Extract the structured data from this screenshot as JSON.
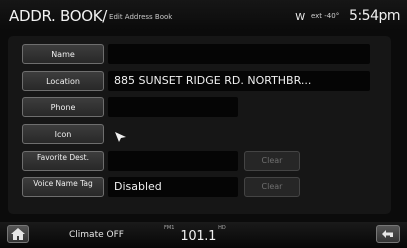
{
  "header": {
    "title": "ADDR. BOOK/",
    "subtitle": "Edit Address Book",
    "compass_icon": "compass-w-icon",
    "compass": "W",
    "outside_temp": "ext -40°",
    "time": "5:54pm"
  },
  "rows": [
    {
      "label": "Name",
      "value": ""
    },
    {
      "label": "Location",
      "value": "885 SUNSET RIDGE RD. NORTHBR..."
    },
    {
      "label": "Phone",
      "value": ""
    },
    {
      "label": "Icon",
      "value": ""
    },
    {
      "label": "Favorite Dest.",
      "value": "",
      "clear": "Clear"
    },
    {
      "label": "Voice Name Tag",
      "value": "Disabled",
      "clear": "Clear"
    }
  ],
  "bottom_bar": {
    "home_icon": "home-icon",
    "climate": "Climate OFF",
    "band": "FM1",
    "frequency": "101.1",
    "station_sub": "HD",
    "back_icon": "back-arrow-icon"
  }
}
